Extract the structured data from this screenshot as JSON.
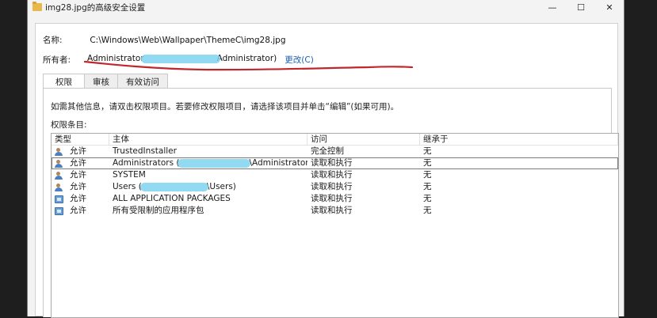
{
  "window": {
    "title": "img28.jpg的高级安全设置",
    "minimize_glyph": "—",
    "maximize_glyph": "☐",
    "close_glyph": "✕"
  },
  "details": {
    "name_label": "名称:",
    "name_value": "C:\\Windows\\Web\\Wallpaper\\ThemeC\\img28.jpg",
    "owner_label": "所有者:",
    "owner_value_left": "Administrator",
    "owner_value_right": "Administrator)",
    "change_link": "更改(C)"
  },
  "tabs": [
    {
      "label": "权限"
    },
    {
      "label": "审核"
    },
    {
      "label": "有效访问"
    }
  ],
  "permissions": {
    "info_text": "如需其他信息，请双击权限项目。若要修改权限项目，请选择该项目并单击“编辑”(如果可用)。",
    "entries_label": "权限条目:",
    "columns": [
      "类型",
      "主体",
      "访问",
      "继承于"
    ],
    "rows": [
      {
        "icon": "user-group-icon",
        "type": "允许",
        "principal_left": "TrustedInstaller",
        "principal_right": "",
        "access": "完全控制",
        "inherited": "无"
      },
      {
        "icon": "user-group-icon",
        "type": "允许",
        "principal_left": "Administrators (",
        "principal_right": "\\Administrators)",
        "access": "读取和执行",
        "inherited": "无"
      },
      {
        "icon": "user-group-icon",
        "type": "允许",
        "principal_left": "SYSTEM",
        "principal_right": "",
        "access": "读取和执行",
        "inherited": "无"
      },
      {
        "icon": "user-group-icon",
        "type": "允许",
        "principal_left": "Users (",
        "principal_right": "\\Users)",
        "access": "读取和执行",
        "inherited": "无"
      },
      {
        "icon": "app-package-icon",
        "type": "允许",
        "principal_left": "ALL APPLICATION PACKAGES",
        "principal_right": "",
        "access": "读取和执行",
        "inherited": "无"
      },
      {
        "icon": "app-package-icon",
        "type": "允许",
        "principal_left": "所有受限制的应用程序包",
        "principal_right": "",
        "access": "读取和执行",
        "inherited": "无"
      }
    ]
  },
  "colors": {
    "link": "#1a5fb4",
    "annotation_underline": "#c0262d",
    "redaction": "#7fd4ee"
  }
}
